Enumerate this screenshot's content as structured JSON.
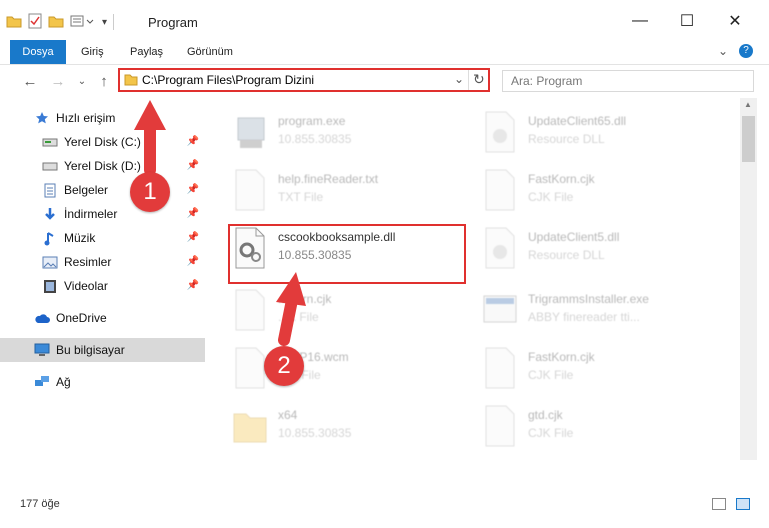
{
  "window": {
    "title": "Program"
  },
  "ribbon": {
    "tabs": [
      "Dosya",
      "Giriş",
      "Paylaş",
      "Görünüm"
    ]
  },
  "address": {
    "path": "C:\\Program Files\\Program Dizini"
  },
  "search": {
    "placeholder": "Ara: Program"
  },
  "sidebar": {
    "quick_access": "Hızlı erişim",
    "items": [
      {
        "label": "Yerel Disk (C:)",
        "icon": "drive-icon"
      },
      {
        "label": "Yerel Disk (D:)",
        "icon": "drive-icon"
      },
      {
        "label": "Belgeler",
        "icon": "documents-icon"
      },
      {
        "label": "İndirmeler",
        "icon": "download-icon"
      },
      {
        "label": "Müzik",
        "icon": "music-icon"
      },
      {
        "label": "Resimler",
        "icon": "pictures-icon"
      },
      {
        "label": "Videolar",
        "icon": "videos-icon"
      }
    ],
    "onedrive": "OneDrive",
    "thispc": "Bu bilgisayar",
    "network": "Ağ"
  },
  "files": [
    {
      "name": "program.exe",
      "sub": "10.855.30835"
    },
    {
      "name": "UpdateClient65.dll",
      "sub": "Resource DLL"
    },
    {
      "name": "help.fineReader.txt",
      "sub": "TXT File"
    },
    {
      "name": "FastKorn.cjk",
      "sub": "CJK File"
    },
    {
      "name": "cscookbooksample.dll",
      "sub": "10.855.30835"
    },
    {
      "name": "UpdateClient5.dll",
      "sub": "Resource DLL"
    },
    {
      "name": "...Korn.cjk",
      "sub": "...K File"
    },
    {
      "name": "TrigrammsInstaller.exe",
      "sub": "ABBY finereader tti..."
    },
    {
      "name": "...WP16.wcm",
      "sub": "...M File"
    },
    {
      "name": "FastKorn.cjk",
      "sub": "CJK File"
    },
    {
      "name": "x64",
      "sub": "10.855.30835"
    },
    {
      "name": "gtd.cjk",
      "sub": "CJK File"
    }
  ],
  "annotations": {
    "step1": "1",
    "step2": "2"
  },
  "status": {
    "count": "177 öğe"
  },
  "colors": {
    "accent": "#1979ca",
    "highlight": "#e0302e"
  }
}
